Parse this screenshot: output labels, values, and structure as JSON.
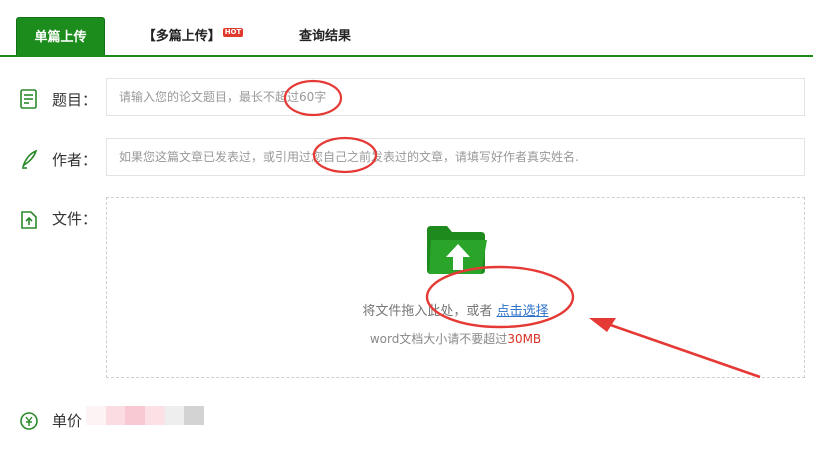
{
  "tabs": {
    "single_label": "单篇上传",
    "multi_label": "【多篇上传】",
    "multi_badge": "HOT",
    "result_label": "查询结果"
  },
  "form": {
    "title_label": "题目：",
    "title_placeholder": "请输入您的论文题目，最长不超过60字",
    "author_label": "作者：",
    "author_placeholder": "如果您这篇文章已发表过，或引用过您自己之前发表过的文章，请填写好作者真实姓名.",
    "file_label": "文件：",
    "drop_text": "将文件拖入此处，或者",
    "drop_link": "点击选择",
    "limit_prefix": "word文档大小请不要超过",
    "limit_size": "30MB",
    "price_label": "单价"
  },
  "colors": {
    "brand_green": "#1c8c1c",
    "annotation_red": "#e53935",
    "link_blue": "#2b73c9"
  },
  "icons": [
    "document-icon",
    "pen-icon",
    "file-upload-icon",
    "folder-upload-icon",
    "price-icon"
  ]
}
